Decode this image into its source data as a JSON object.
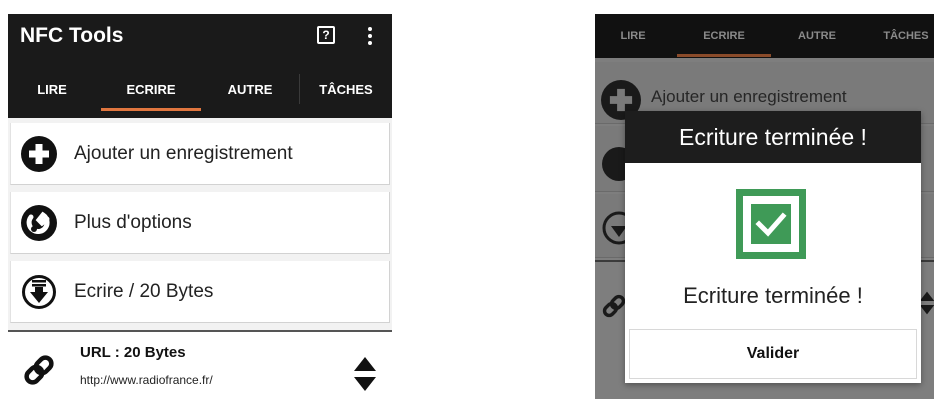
{
  "left": {
    "app_title": "NFC Tools",
    "icons": {
      "help": "help-icon",
      "help_glyph": "?",
      "more": "more-vert-icon"
    },
    "tabs": [
      {
        "label": "LIRE"
      },
      {
        "label": "ECRIRE",
        "active": true
      },
      {
        "label": "AUTRE"
      },
      {
        "label": "TÂCHES"
      }
    ],
    "cards": [
      {
        "label": "Ajouter un enregistrement",
        "icon": "add-circle-icon"
      },
      {
        "label": "Plus d'options",
        "icon": "wrench-icon"
      },
      {
        "label": "Ecrire / 20 Bytes",
        "icon": "write-download-icon"
      }
    ],
    "record": {
      "title": "URL : 20 Bytes",
      "value": "http://www.radiofrance.fr/",
      "icon": "link-icon",
      "handle_icon": "reorder-icon"
    }
  },
  "right": {
    "tabs": [
      {
        "label": "LIRE"
      },
      {
        "label": "ECRIRE",
        "active": true
      },
      {
        "label": "AUTRE"
      },
      {
        "label": "TÂCHES"
      }
    ],
    "background_card_label": "Ajouter un enregistrement",
    "dialog": {
      "title": "Ecriture terminée !",
      "message": "Ecriture terminée !",
      "button": "Valider",
      "icon": "check-icon"
    }
  },
  "colors": {
    "appbar": "#1a1a1a",
    "accent": "#e0763f",
    "success": "#3f9a57"
  }
}
